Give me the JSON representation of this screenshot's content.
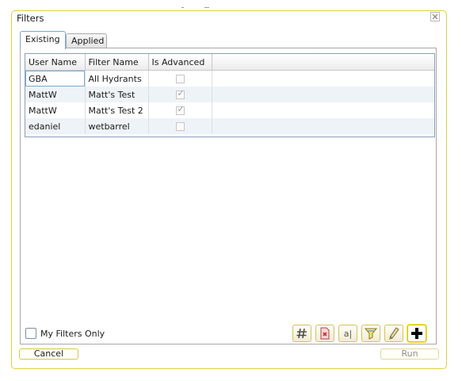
{
  "dialog": {
    "title": "Filters",
    "close_icon": "close-x-icon"
  },
  "tabs": [
    {
      "label": "Existing",
      "selected": true
    },
    {
      "label": "Applied",
      "selected": false
    }
  ],
  "grid": {
    "columns": [
      "User Name",
      "Filter Name",
      "Is Advanced"
    ],
    "rows": [
      {
        "user": "GBA",
        "filter": "All Hydrants",
        "advanced": false
      },
      {
        "user": "MattW",
        "filter": "Matt's Test",
        "advanced": true
      },
      {
        "user": "MattW",
        "filter": "Matt's Test 2",
        "advanced": true
      },
      {
        "user": "edaniel",
        "filter": "wetbarrel",
        "advanced": false
      }
    ]
  },
  "options": {
    "my_filters_only_label": "My Filters Only",
    "my_filters_only_checked": false
  },
  "toolbar": {
    "buttons": [
      {
        "icon": "hash-icon"
      },
      {
        "icon": "delete-document-icon"
      },
      {
        "icon": "text-cursor-icon",
        "glyph": "a|"
      },
      {
        "icon": "funnel-icon"
      },
      {
        "icon": "pencil-icon"
      },
      {
        "icon": "plus-icon"
      }
    ]
  },
  "footer": {
    "cancel_label": "Cancel",
    "run_label": "Run",
    "run_enabled": false
  },
  "colors": {
    "dialog_border": "#e2cf3c",
    "grid_alt_row": "#eef3f8",
    "selection_outline": "#79a9d6"
  }
}
